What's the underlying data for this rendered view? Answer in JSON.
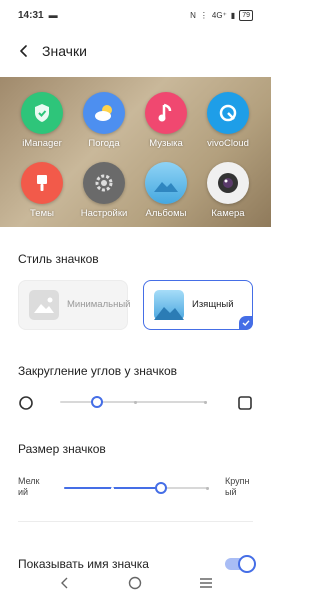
{
  "statusbar": {
    "time": "14:31",
    "network": "4G⁺",
    "battery": "79"
  },
  "header": {
    "title": "Значки"
  },
  "preview": {
    "apps": [
      {
        "label": "iManager",
        "icon": "shield-icon",
        "color": "#2ec57a"
      },
      {
        "label": "Погода",
        "icon": "weather-icon",
        "color": "#4d8ff0"
      },
      {
        "label": "Музыка",
        "icon": "music-icon",
        "color": "#f04870"
      },
      {
        "label": "vivoCloud",
        "icon": "cloud-icon",
        "color": "#1e9ee8"
      },
      {
        "label": "Темы",
        "icon": "brush-icon",
        "color": "#f25a4a"
      },
      {
        "label": "Настройки",
        "icon": "gear-icon",
        "color": "#6a6a6a"
      },
      {
        "label": "Альбомы",
        "icon": "landscape-icon",
        "color": "#46a8e0"
      },
      {
        "label": "Камера",
        "icon": "camera-icon",
        "color": "#3a3a3a"
      }
    ]
  },
  "icon_style": {
    "title": "Стиль значков",
    "minimal": "Минимальный",
    "elegant": "Изящный",
    "selected": "elegant"
  },
  "corner_rounding": {
    "title": "Закругление углов у значков",
    "value": 0.25
  },
  "icon_size": {
    "title": "Размер значков",
    "small_label": "Мелкий",
    "large_label": "Крупный",
    "value": 0.67
  },
  "show_name": {
    "label": "Показывать имя значка",
    "enabled": true
  },
  "colors": {
    "accent": "#456ee6"
  }
}
